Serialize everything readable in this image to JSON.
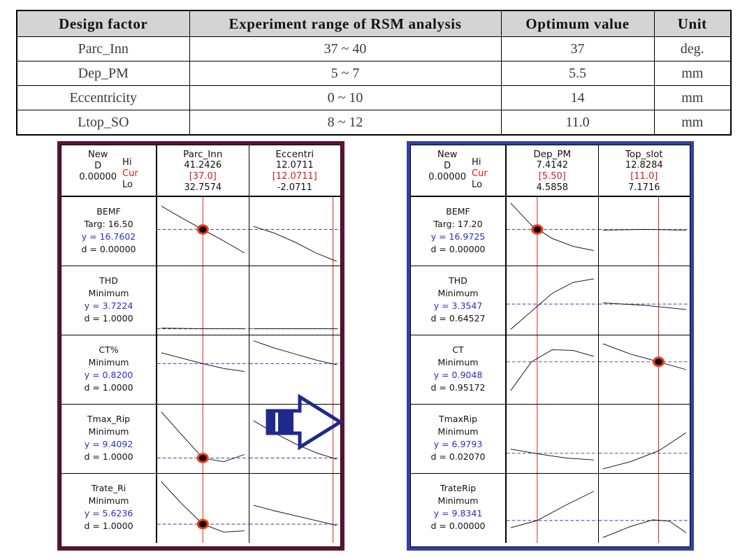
{
  "factor_table": {
    "headers": [
      "Design factor",
      "Experiment range of RSM analysis",
      "Optimum value",
      "Unit"
    ],
    "rows": [
      {
        "factor": "Parc_Inn",
        "range": "37  ~  40",
        "optimum": "37",
        "unit": "deg."
      },
      {
        "factor": "Dep_PM",
        "range": "5  ~  7",
        "optimum": "5.5",
        "unit": "mm"
      },
      {
        "factor": "Eccentricity",
        "range": "0  ~  10",
        "optimum": "14",
        "unit": "mm"
      },
      {
        "factor": "Ltop_SO",
        "range": "8  ~  12",
        "optimum": "11.0",
        "unit": "mm"
      }
    ]
  },
  "colors": {
    "left_panel_border": "#5c1335",
    "right_panel_border": "#3341a0",
    "current_setting_red": "#d81a1a",
    "response_value_blue": "#2b2bc9",
    "target_dash_blue": "#3a3ab4",
    "marker_ring_orange": "#f03c10",
    "arrow_navy": "#1f2a8c",
    "header_fill_gray": "#d4d4d4"
  },
  "left_panel": {
    "composite": {
      "title_new": "New",
      "title_d": "D",
      "value": "0.00000",
      "hi": "Hi",
      "cur": "Cur",
      "lo": "Lo"
    },
    "factors": [
      {
        "name": "Parc_Inn",
        "hi": "41.2426",
        "cur": "[37.0]",
        "lo": "32.7574"
      },
      {
        "name": "Eccentri",
        "hi": "12.0711",
        "cur": "[12.0711]",
        "lo": "-2.0711"
      }
    ],
    "responses": [
      {
        "name": "BEMF",
        "goal": "Targ: 16.50",
        "y": "y = 16.7602",
        "d": "d = 0.00000"
      },
      {
        "name": "THD",
        "goal": "Minimum",
        "y": "y = 3.7224",
        "d": "d = 1.0000"
      },
      {
        "name": "CT%",
        "goal": "Minimum",
        "y": "y = 0.8200",
        "d": "d = 1.0000"
      },
      {
        "name": "Tmax_Rip",
        "goal": "Minimum",
        "y": "y = 9.4092",
        "d": "d = 1.0000"
      },
      {
        "name": "Trate_Ri",
        "goal": "Minimum",
        "y": "y = 5.6236",
        "d": "d = 1.0000"
      }
    ]
  },
  "right_panel": {
    "composite": {
      "title_new": "New",
      "title_d": "D",
      "value": "0.00000",
      "hi": "Hi",
      "cur": "Cur",
      "lo": "Lo"
    },
    "factors": [
      {
        "name": "Dep_PM",
        "hi": "7.4142",
        "cur": "[5.50]",
        "lo": "4.5858"
      },
      {
        "name": "Top_slot",
        "hi": "12.8284",
        "cur": "[11.0]",
        "lo": "7.1716"
      }
    ],
    "responses": [
      {
        "name": "BEMF",
        "goal": "Targ: 17.20",
        "y": "y = 16.9725",
        "d": "d = 0.00000"
      },
      {
        "name": "THD",
        "goal": "Minimum",
        "y": "y = 3.3547",
        "d": "d = 0.64527"
      },
      {
        "name": "CT",
        "goal": "Minimum",
        "y": "y = 0.9048",
        "d": "d = 0.95172"
      },
      {
        "name": "TmaxRip",
        "goal": "Minimum",
        "y": "y = 6.9793",
        "d": "d = 0.02070"
      },
      {
        "name": "TrateRip",
        "goal": "Minimum",
        "y": "y = 9.8341",
        "d": "d = 0.00000"
      }
    ]
  },
  "chart_data": [
    {
      "type": "line",
      "title": "Response optimization plot (left) - Parc_Inn / Eccentri",
      "grid": false,
      "legend": "none",
      "composite_desirability": 0.0,
      "factors": [
        {
          "name": "Parc_Inn",
          "low": 32.7574,
          "current": 37.0,
          "high": 41.2426,
          "cursor_frac": 0.5
        },
        {
          "name": "Eccentri",
          "low": -2.0711,
          "current": 12.0711,
          "high": 12.0711,
          "cursor_frac": 0.955
        }
      ],
      "responses": [
        {
          "name": "BEMF",
          "goal": "Target",
          "target": 16.5,
          "y": 16.7602,
          "d": 0.0,
          "curves": [
            {
              "factor": "Parc_Inn",
              "shape": "decreasing",
              "points": [
                [
                  0.0,
                  0.92
                ],
                [
                  0.25,
                  0.72
                ],
                [
                  0.5,
                  0.53
                ],
                [
                  0.75,
                  0.34
                ],
                [
                  1.0,
                  0.14
                ]
              ],
              "marker_at": 0.5
            },
            {
              "factor": "Eccentri",
              "shape": "decreasing-convex",
              "points": [
                [
                  0.0,
                  0.58
                ],
                [
                  0.25,
                  0.47
                ],
                [
                  0.5,
                  0.32
                ],
                [
                  0.75,
                  0.14
                ],
                [
                  1.0,
                  0.0
                ]
              ],
              "marker_at": null
            }
          ],
          "target_line_y": 0.53
        },
        {
          "name": "THD",
          "goal": "Minimum",
          "y": 3.7224,
          "d": 1.0,
          "curves": [
            {
              "factor": "Parc_Inn",
              "shape": "flat-low",
              "points": [
                [
                  0.0,
                  0.04
                ],
                [
                  0.5,
                  0.03
                ],
                [
                  1.0,
                  0.03
                ]
              ],
              "marker_at": null
            },
            {
              "factor": "Eccentri",
              "shape": "flat-low",
              "points": [
                [
                  0.0,
                  0.03
                ],
                [
                  0.5,
                  0.03
                ],
                [
                  1.0,
                  0.03
                ]
              ],
              "marker_at": null
            }
          ],
          "target_line_y": 0.03
        },
        {
          "name": "CT%",
          "goal": "Minimum",
          "y": 0.82,
          "d": 1.0,
          "curves": [
            {
              "factor": "Parc_Inn",
              "shape": "decreasing",
              "points": [
                [
                  0.0,
                  0.78
                ],
                [
                  0.25,
                  0.69
                ],
                [
                  0.5,
                  0.6
                ],
                [
                  0.75,
                  0.52
                ],
                [
                  1.0,
                  0.47
                ]
              ],
              "marker_at": null
            },
            {
              "factor": "Eccentri",
              "shape": "decreasing",
              "points": [
                [
                  0.0,
                  0.98
                ],
                [
                  0.25,
                  0.86
                ],
                [
                  0.5,
                  0.76
                ],
                [
                  0.75,
                  0.66
                ],
                [
                  1.0,
                  0.58
                ]
              ],
              "marker_at": null
            }
          ],
          "target_line_y": 0.6
        },
        {
          "name": "Tmax_Rip",
          "goal": "Minimum",
          "y": 9.4092,
          "d": 1.0,
          "curves": [
            {
              "factor": "Parc_Inn",
              "shape": "u-shape",
              "points": [
                [
                  0.0,
                  0.95
                ],
                [
                  0.25,
                  0.56
                ],
                [
                  0.5,
                  0.18
                ],
                [
                  0.75,
                  0.12
                ],
                [
                  1.0,
                  0.24
                ]
              ],
              "marker_at": 0.5
            },
            {
              "factor": "Eccentri",
              "shape": "decreasing",
              "points": [
                [
                  0.0,
                  0.8
                ],
                [
                  0.25,
                  0.6
                ],
                [
                  0.5,
                  0.42
                ],
                [
                  0.75,
                  0.27
                ],
                [
                  1.0,
                  0.16
                ]
              ],
              "marker_at": null
            }
          ],
          "target_line_y": 0.18
        },
        {
          "name": "Trate_Ri",
          "goal": "Minimum",
          "y": 5.6236,
          "d": 1.0,
          "curves": [
            {
              "factor": "Parc_Inn",
              "shape": "u-shape",
              "points": [
                [
                  0.0,
                  0.94
                ],
                [
                  0.25,
                  0.57
                ],
                [
                  0.5,
                  0.24
                ],
                [
                  0.75,
                  0.11
                ],
                [
                  1.0,
                  0.13
                ]
              ],
              "marker_at": 0.5
            },
            {
              "factor": "Eccentri",
              "shape": "decreasing",
              "points": [
                [
                  0.0,
                  0.55
                ],
                [
                  0.25,
                  0.46
                ],
                [
                  0.5,
                  0.38
                ],
                [
                  0.75,
                  0.3
                ],
                [
                  1.0,
                  0.22
                ]
              ],
              "marker_at": null
            }
          ],
          "target_line_y": 0.24
        }
      ]
    },
    {
      "type": "line",
      "title": "Response optimization plot (right) - Dep_PM / Top_slot",
      "grid": false,
      "legend": "none",
      "composite_desirability": 0.0,
      "factors": [
        {
          "name": "Dep_PM",
          "low": 4.5858,
          "current": 5.5,
          "high": 7.4142,
          "cursor_frac": 0.32
        },
        {
          "name": "Top_slot",
          "low": 7.1716,
          "current": 11.0,
          "high": 12.8284,
          "cursor_frac": 0.67
        }
      ],
      "responses": [
        {
          "name": "BEMF",
          "goal": "Target",
          "target": 17.2,
          "y": 16.9725,
          "d": 0.0,
          "curves": [
            {
              "factor": "Dep_PM",
              "shape": "decreasing-convex",
              "points": [
                [
                  0.0,
                  0.97
                ],
                [
                  0.25,
                  0.6
                ],
                [
                  0.5,
                  0.38
                ],
                [
                  0.75,
                  0.25
                ],
                [
                  1.0,
                  0.18
                ]
              ],
              "marker_at": 0.32
            },
            {
              "factor": "Top_slot",
              "shape": "flat",
              "points": [
                [
                  0.0,
                  0.52
                ],
                [
                  0.5,
                  0.53
                ],
                [
                  1.0,
                  0.52
                ]
              ],
              "marker_at": null
            }
          ],
          "target_line_y": 0.53
        },
        {
          "name": "THD",
          "goal": "Minimum",
          "y": 3.3547,
          "d": 0.64527,
          "curves": [
            {
              "factor": "Dep_PM",
              "shape": "increasing-concave",
              "points": [
                [
                  0.0,
                  0.02
                ],
                [
                  0.25,
                  0.32
                ],
                [
                  0.5,
                  0.62
                ],
                [
                  0.75,
                  0.8
                ],
                [
                  1.0,
                  0.86
                ]
              ],
              "marker_at": null
            },
            {
              "factor": "Top_slot",
              "shape": "slightly-decreasing",
              "points": [
                [
                  0.0,
                  0.46
                ],
                [
                  0.5,
                  0.42
                ],
                [
                  1.0,
                  0.35
                ]
              ],
              "marker_at": null
            }
          ],
          "target_line_y": 0.44
        },
        {
          "name": "CT",
          "goal": "Minimum",
          "y": 0.9048,
          "d": 0.95172,
          "curves": [
            {
              "factor": "Dep_PM",
              "shape": "hump",
              "points": [
                [
                  0.0,
                  0.15
                ],
                [
                  0.25,
                  0.63
                ],
                [
                  0.5,
                  0.83
                ],
                [
                  0.75,
                  0.82
                ],
                [
                  1.0,
                  0.72
                ]
              ],
              "marker_at": null
            },
            {
              "factor": "Top_slot",
              "shape": "decreasing",
              "points": [
                [
                  0.0,
                  0.93
                ],
                [
                  0.33,
                  0.76
                ],
                [
                  0.67,
                  0.63
                ],
                [
                  1.0,
                  0.5
                ]
              ],
              "marker_at": 0.67
            }
          ],
          "target_line_y": 0.63
        },
        {
          "name": "TmaxRip",
          "goal": "Minimum",
          "y": 6.9793,
          "d": 0.0207,
          "curves": [
            {
              "factor": "Dep_PM",
              "shape": "slightly-decreasing",
              "points": [
                [
                  0.0,
                  0.33
                ],
                [
                  0.33,
                  0.25
                ],
                [
                  0.67,
                  0.18
                ],
                [
                  1.0,
                  0.15
                ]
              ],
              "marker_at": null
            },
            {
              "factor": "Top_slot",
              "shape": "increasing-convex",
              "points": [
                [
                  0.0,
                  0.0
                ],
                [
                  0.33,
                  0.12
                ],
                [
                  0.67,
                  0.3
                ],
                [
                  1.0,
                  0.6
                ]
              ],
              "marker_at": null
            }
          ],
          "target_line_y": 0.26
        },
        {
          "name": "TrateRip",
          "goal": "Minimum",
          "y": 9.8341,
          "d": 0.0,
          "curves": [
            {
              "factor": "Dep_PM",
              "shape": "increasing",
              "points": [
                [
                  0.0,
                  0.18
                ],
                [
                  0.32,
                  0.3
                ],
                [
                  0.66,
                  0.55
                ],
                [
                  1.0,
                  0.78
                ]
              ],
              "marker_at": null
            },
            {
              "factor": "Top_slot",
              "shape": "hump",
              "points": [
                [
                  0.0,
                  0.02
                ],
                [
                  0.33,
                  0.2
                ],
                [
                  0.6,
                  0.31
                ],
                [
                  0.8,
                  0.29
                ],
                [
                  1.0,
                  0.1
                ]
              ],
              "marker_at": null
            }
          ],
          "target_line_y": 0.3
        }
      ]
    }
  ],
  "arrow": {
    "name": "transfer-arrow",
    "direction": "right"
  }
}
